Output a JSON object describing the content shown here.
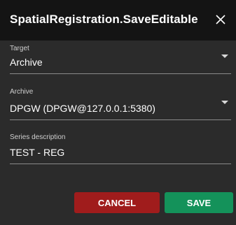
{
  "dialog": {
    "title": "SpatialRegistration.SaveEditable",
    "close_icon": "close-icon"
  },
  "fields": {
    "target": {
      "label": "Target",
      "value": "Archive"
    },
    "archive": {
      "label": "Archive",
      "value": "DPGW (DPGW@127.0.0.1:5380)"
    },
    "series_description": {
      "label": "Series description",
      "value": "TEST - REG"
    }
  },
  "buttons": {
    "cancel": "CANCEL",
    "save": "SAVE"
  },
  "colors": {
    "titlebar": "#141414",
    "background": "#2b2b2b",
    "cancel": "#a01c1c",
    "save": "#14925a"
  }
}
